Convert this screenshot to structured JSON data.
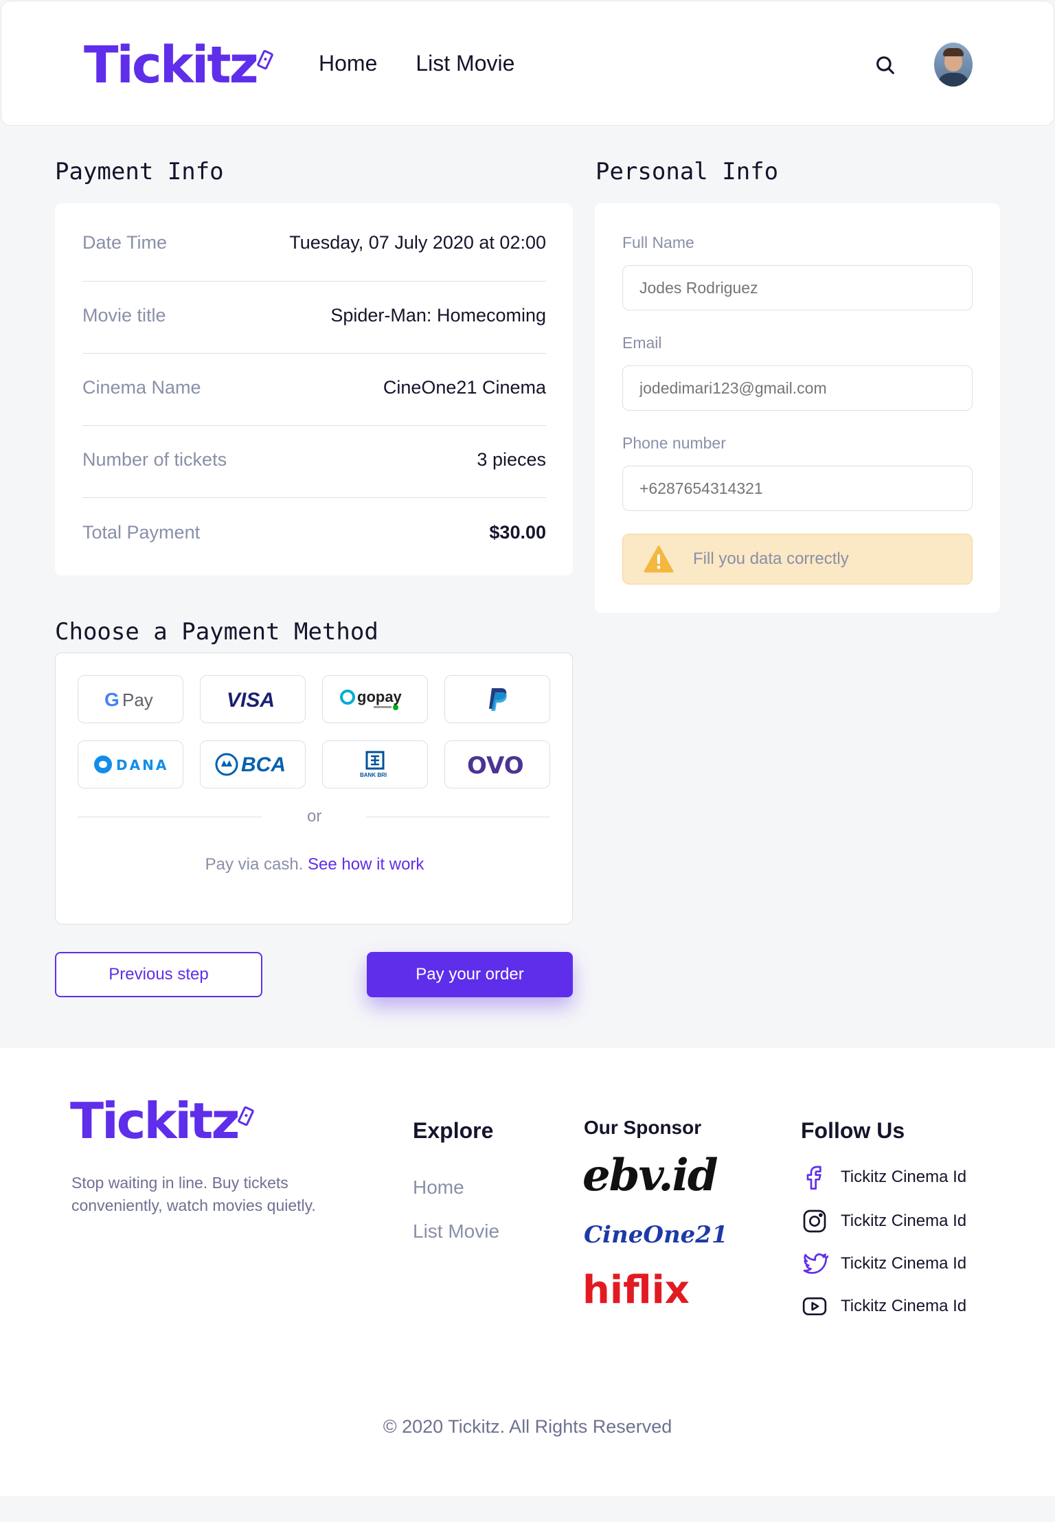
{
  "header": {
    "logo_text": "Tickitz",
    "nav": [
      "Home",
      "List Movie"
    ]
  },
  "payment_info": {
    "title": "Payment Info",
    "rows": [
      {
        "label": "Date Time",
        "value": "Tuesday, 07 July 2020 at 02:00"
      },
      {
        "label": "Movie title",
        "value": "Spider-Man: Homecoming"
      },
      {
        "label": "Cinema Name",
        "value": "CineOne21 Cinema"
      },
      {
        "label": "Number of tickets",
        "value": "3 pieces"
      },
      {
        "label": "Total Payment",
        "value": "$30.00"
      }
    ]
  },
  "personal_info": {
    "title": "Personal Info",
    "full_name_label": "Full Name",
    "full_name_placeholder": "Jodes Rodriguez",
    "email_label": "Email",
    "email_placeholder": "jodedimari123@gmail.com",
    "phone_label": "Phone number",
    "phone_placeholder": "+6287654314321",
    "warning_text": "Fill you data correctly"
  },
  "payment_method": {
    "title": "Choose a Payment Method",
    "methods": [
      "G Pay",
      "VISA",
      "gopay",
      "PayPal",
      "DANA",
      "BCA",
      "BANK BRI",
      "OVO"
    ],
    "or_text": "or",
    "cash_text": "Pay via cash. ",
    "cash_link": "See how it work"
  },
  "actions": {
    "previous_label": "Previous step",
    "pay_label": "Pay your order"
  },
  "footer": {
    "logo_text": "Tickitz",
    "tagline": "Stop waiting in line. Buy tickets conveniently, watch movies quietly.",
    "explore_title": "Explore",
    "explore_links": [
      "Home",
      "List Movie"
    ],
    "sponsor_title": "Our Sponsor",
    "sponsors": [
      "ebv.id",
      "CineOne21",
      "hiflix"
    ],
    "follow_title": "Follow Us",
    "social": [
      {
        "icon": "facebook-icon",
        "label": "Tickitz Cinema Id"
      },
      {
        "icon": "instagram-icon",
        "label": "Tickitz Cinema Id"
      },
      {
        "icon": "twitter-icon",
        "label": "Tickitz Cinema Id"
      },
      {
        "icon": "youtube-icon",
        "label": "Tickitz Cinema Id"
      }
    ],
    "copyright": "© 2020 Tickitz. All Rights Reserved"
  },
  "colors": {
    "accent": "#5f2eea",
    "background": "#f5f6f8",
    "muted": "#8a8fa8",
    "warning_bg": "#fbe8c4"
  }
}
